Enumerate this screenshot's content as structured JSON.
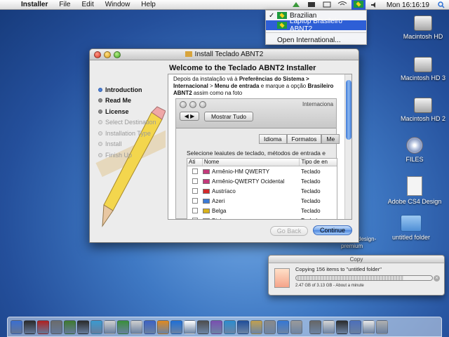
{
  "menubar": {
    "app_name": "Installer",
    "menus": [
      "File",
      "Edit",
      "Window",
      "Help"
    ],
    "clock": "Mon 16:16:19"
  },
  "input_menu": {
    "items": [
      {
        "label": "Brazilian",
        "checked": true
      },
      {
        "label": "Laptop Brasileiro ABNT2",
        "selected": true
      }
    ],
    "open_international": "Open International..."
  },
  "desktop": {
    "icons": [
      {
        "label": "Macintosh HD",
        "kind": "hd"
      },
      {
        "label": "Macintosh HD 3",
        "kind": "hd"
      },
      {
        "label": "Macintosh HD 2",
        "kind": "hd"
      },
      {
        "label": "FILES",
        "kind": "cd"
      },
      {
        "label": "Adobe CS4 Design",
        "kind": "doc"
      },
      {
        "label": "untitled folder",
        "kind": "folder"
      }
    ],
    "partial_labels": [
      "design-",
      "premium"
    ]
  },
  "installer": {
    "window_title": "Install Teclado ABNT2",
    "heading": "Welcome to the Teclado ABNT2 Installer",
    "steps": [
      {
        "label": "Introduction",
        "state": "active"
      },
      {
        "label": "Read Me",
        "state": "done"
      },
      {
        "label": "License",
        "state": "done"
      },
      {
        "label": "Select Destination",
        "state": "todo"
      },
      {
        "label": "Installation Type",
        "state": "todo"
      },
      {
        "label": "Install",
        "state": "todo"
      },
      {
        "label": "Finish Up",
        "state": "todo"
      }
    ],
    "intro_text": {
      "p1": "Depois da instalação vá à ",
      "b1": "Preferências  do Sistema > Internacional",
      "p2": " > ",
      "b2": "Menu de entrada",
      "p3": " e marque a opção ",
      "b3": "Brasileiro ABNT2",
      "p4": " assim como na foto"
    },
    "prefs_window": {
      "title": "Internaciona",
      "show_all": "Mostrar Tudo",
      "tabs": [
        "Idioma",
        "Formatos",
        "Me"
      ],
      "description": "Selecione leaiutes de teclado, métodos de entrada e",
      "columns": [
        "Ati",
        "Nome",
        "Tipo de en"
      ],
      "rows": [
        {
          "name": "Armênio-HM QWERTY",
          "type": "Teclado",
          "flag": "#c43a7b"
        },
        {
          "name": "Armênio-QWERTY Ocidental",
          "type": "Teclado",
          "flag": "#c43a7b"
        },
        {
          "name": "Austríaco",
          "type": "Teclado",
          "flag": "#d42a2a"
        },
        {
          "name": "Azeri",
          "type": "Teclado",
          "flag": "#3a7ad6"
        },
        {
          "name": "Belga",
          "type": "Teclado",
          "flag": "#d9b21a"
        },
        {
          "name": "Bielo-russo",
          "type": "Teclado",
          "flag": "#c92b2b"
        }
      ]
    },
    "buttons": {
      "back": "Go Back",
      "continue": "Continue"
    }
  },
  "copy_dialog": {
    "title": "Copy",
    "status": "Copying 156 items to \"untitled folder\"",
    "detail": "2.47 GB of 3.13 GB - About a minute",
    "progress": 0.79
  },
  "dock_colors": [
    "#3b6fd0",
    "#2a2a2a",
    "#b02020",
    "#6b6b6b",
    "#3e7a2e",
    "#2a2a2a",
    "#3a9ad0",
    "#d0d0d0",
    "#3a8f3a",
    "#cfcfcf",
    "#3c62c4",
    "#e08a20",
    "#1f6fd6",
    "#ffffff",
    "#4d4d4d",
    "#7a4fb0",
    "#2b8ccf",
    "#1f4e9a",
    "#c0a050",
    "#8a8a8a",
    "#3577d4",
    "#9a9a9a",
    "#666666",
    "#d4d4d4",
    "#2b2b2b",
    "#4c6fba",
    "#e8e8e8",
    "#b0b0b0"
  ]
}
